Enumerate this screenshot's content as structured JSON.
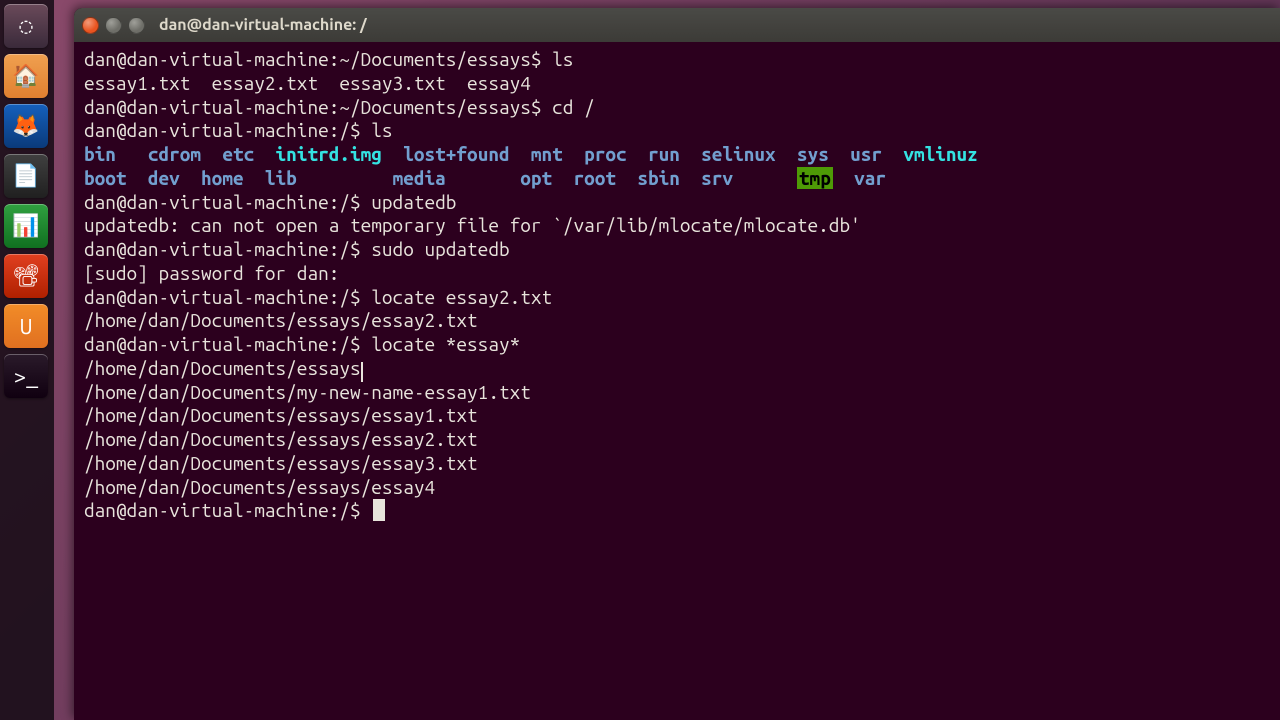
{
  "launcher": {
    "items": [
      {
        "name": "dash-icon",
        "glyph": "◌"
      },
      {
        "name": "files-icon",
        "glyph": "🏠"
      },
      {
        "name": "firefox-icon",
        "glyph": "🦊"
      },
      {
        "name": "writer-icon",
        "glyph": "📄"
      },
      {
        "name": "calc-icon",
        "glyph": "📊"
      },
      {
        "name": "impress-icon",
        "glyph": "📽"
      },
      {
        "name": "usc-icon",
        "glyph": "U"
      },
      {
        "name": "terminal-icon",
        "glyph": ">_"
      }
    ]
  },
  "window": {
    "title": "dan@dan-virtual-machine: /"
  },
  "terminal": {
    "prompt1": "dan@dan-virtual-machine:~/Documents/essays$ ",
    "cmd1": "ls",
    "ls1": "essay1.txt  essay2.txt  essay3.txt  essay4",
    "prompt2": "dan@dan-virtual-machine:~/Documents/essays$ ",
    "cmd2": "cd /",
    "prompt3": "dan@dan-virtual-machine:/$ ",
    "cmd3": "ls",
    "root_row1": {
      "bin": "bin",
      "cdrom": "cdrom",
      "etc": "etc",
      "initrd": "initrd.img",
      "lost": "lost+found",
      "mnt": "mnt",
      "proc": "proc",
      "run": "run",
      "selinux": "selinux",
      "sys": "sys",
      "usr": "usr",
      "vmlinuz": "vmlinuz"
    },
    "root_row2": {
      "boot": "boot",
      "dev": "dev",
      "home": "home",
      "lib": "lib",
      "media": "media",
      "opt": "opt",
      "root": "root",
      "sbin": "sbin",
      "srv": "srv",
      "tmp": "tmp",
      "var": "var"
    },
    "prompt4": "dan@dan-virtual-machine:/$ ",
    "cmd4": "updatedb",
    "err1": "updatedb: can not open a temporary file for `/var/lib/mlocate/mlocate.db'",
    "prompt5": "dan@dan-virtual-machine:/$ ",
    "cmd5": "sudo updatedb",
    "sudo_pw": "[sudo] password for dan:",
    "prompt6": "dan@dan-virtual-machine:/$ ",
    "cmd6": "locate essay2.txt",
    "loc1": "/home/dan/Documents/essays/essay2.txt",
    "prompt7": "dan@dan-virtual-machine:/$ ",
    "cmd7": "locate *essay*",
    "loc2": "/home/dan/Documents/essays",
    "loc3": "/home/dan/Documents/my-new-name-essay1.txt",
    "loc4": "/home/dan/Documents/essays/essay1.txt",
    "loc5": "/home/dan/Documents/essays/essay2.txt",
    "loc6": "/home/dan/Documents/essays/essay3.txt",
    "loc7": "/home/dan/Documents/essays/essay4",
    "prompt8": "dan@dan-virtual-machine:/$ "
  }
}
